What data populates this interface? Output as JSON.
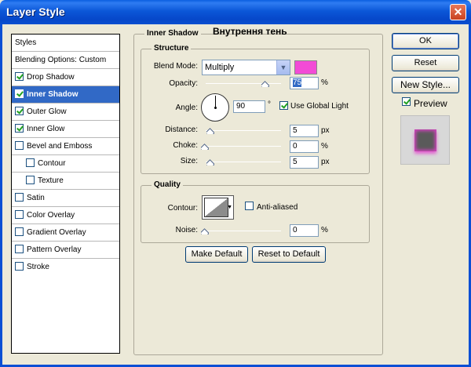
{
  "window": {
    "title": "Layer Style",
    "close_glyph": "✕"
  },
  "styles_list": {
    "header": "Styles",
    "blending": "Blending Options: Custom",
    "items": [
      {
        "label": "Drop Shadow",
        "checked": true
      },
      {
        "label": "Inner Shadow",
        "checked": true,
        "selected": true
      },
      {
        "label": "Outer Glow",
        "checked": true
      },
      {
        "label": "Inner Glow",
        "checked": true
      },
      {
        "label": "Bevel and Emboss",
        "checked": false
      },
      {
        "label": "Contour",
        "checked": false,
        "sub": true
      },
      {
        "label": "Texture",
        "checked": false,
        "sub": true
      },
      {
        "label": "Satin",
        "checked": false
      },
      {
        "label": "Color Overlay",
        "checked": false
      },
      {
        "label": "Gradient Overlay",
        "checked": false
      },
      {
        "label": "Pattern Overlay",
        "checked": false
      },
      {
        "label": "Stroke",
        "checked": false
      }
    ]
  },
  "panel": {
    "title": "Inner Shadow",
    "annotation": "Внутрення тень",
    "structure": {
      "title": "Structure",
      "blend_mode_label": "Blend Mode:",
      "blend_mode": "Multiply",
      "shadow_color": "#f24bd6",
      "opacity_label": "Opacity:",
      "opacity": "75",
      "opacity_unit": "%",
      "opacity_pct": 75,
      "angle_label": "Angle:",
      "angle": "90",
      "angle_unit": "°",
      "use_global_light_label": "Use Global Light",
      "use_global_light": true,
      "distance_label": "Distance:",
      "distance": "5",
      "distance_unit": "px",
      "distance_pct": 2,
      "choke_label": "Choke:",
      "choke": "0",
      "choke_unit": "%",
      "choke_pct": 0,
      "size_label": "Size:",
      "size": "5",
      "size_unit": "px",
      "size_pct": 2
    },
    "quality": {
      "title": "Quality",
      "contour_label": "Contour:",
      "anti_aliased_label": "Anti-aliased",
      "anti_aliased": false,
      "noise_label": "Noise:",
      "noise": "0",
      "noise_unit": "%",
      "noise_pct": 0
    },
    "make_default": "Make Default",
    "reset_default": "Reset to Default"
  },
  "buttons": {
    "ok": "OK",
    "reset": "Reset",
    "new_style": "New Style...",
    "preview_label": "Preview",
    "preview": true
  }
}
